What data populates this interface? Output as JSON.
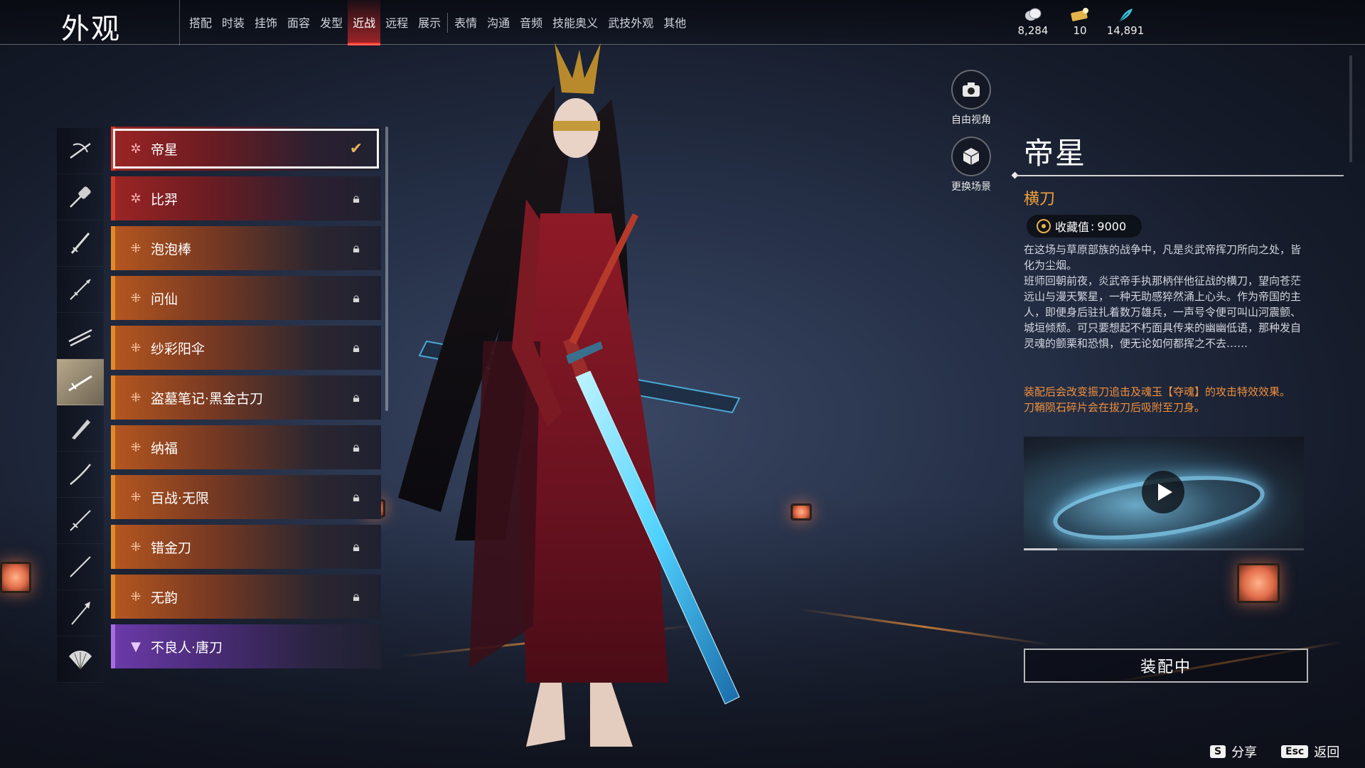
{
  "header": {
    "title": "外观",
    "tabs": [
      {
        "label": "搭配"
      },
      {
        "label": "时装"
      },
      {
        "label": "挂饰"
      },
      {
        "label": "面容"
      },
      {
        "label": "发型"
      },
      {
        "label": "近战",
        "active": true
      },
      {
        "label": "远程"
      },
      {
        "label": "展示"
      },
      {
        "label": "表情"
      },
      {
        "label": "沟通"
      },
      {
        "label": "音频"
      },
      {
        "label": "技能奥义"
      },
      {
        "label": "武技外观"
      },
      {
        "label": "其他"
      }
    ],
    "currencies": [
      {
        "icon": "coins-icon",
        "value": "8,284"
      },
      {
        "icon": "ticket-icon",
        "value": "10"
      },
      {
        "icon": "feather-icon",
        "value": "14,891"
      }
    ]
  },
  "categories": [
    {
      "icon": "scythe-icon"
    },
    {
      "icon": "mace-icon"
    },
    {
      "icon": "sword-icon"
    },
    {
      "icon": "spear-icon"
    },
    {
      "icon": "twin-blades-icon"
    },
    {
      "icon": "long-saber-icon",
      "active": true
    },
    {
      "icon": "broad-blade-icon"
    },
    {
      "icon": "katana-icon"
    },
    {
      "icon": "dual-swords-icon"
    },
    {
      "icon": "staff-icon"
    },
    {
      "icon": "glaive-icon"
    },
    {
      "icon": "fan-icon"
    }
  ],
  "items": [
    {
      "name": "帝星",
      "rarity": "red",
      "selected": true,
      "equipped": true,
      "locked": false
    },
    {
      "name": "比羿",
      "rarity": "red",
      "locked": true
    },
    {
      "name": "泡泡棒",
      "rarity": "gold",
      "locked": true
    },
    {
      "name": "问仙",
      "rarity": "gold",
      "locked": true
    },
    {
      "name": "纱彩阳伞",
      "rarity": "gold",
      "locked": true
    },
    {
      "name": "盗墓笔记·黑金古刀",
      "rarity": "gold",
      "locked": true
    },
    {
      "name": "纳福",
      "rarity": "gold",
      "locked": true
    },
    {
      "name": "百战·无限",
      "rarity": "gold",
      "locked": true
    },
    {
      "name": "错金刀",
      "rarity": "gold",
      "locked": true
    },
    {
      "name": "无韵",
      "rarity": "gold",
      "locked": true
    },
    {
      "name": "不良人·唐刀",
      "rarity": "purple",
      "locked": false
    }
  ],
  "side_buttons": {
    "free_view": "自由视角",
    "change_scene": "更换场景"
  },
  "detail": {
    "name": "帝星",
    "type": "横刀",
    "collect_label": "收藏值",
    "collect_value": "9000",
    "description": [
      "在这场与草原部族的战争中，凡是炎武帝挥刀所向之处，皆化为尘烟。",
      "班师回朝前夜，炎武帝手执那柄伴他征战的横刀，望向苍茫远山与漫天繁星，一种无助感猝然涌上心头。作为帝国的主人，即便身后驻扎着数万雄兵，一声号令便可叫山河震颤、城垣倾颓。可只要想起不朽面具传来的幽幽低语，那种发自灵魂的颤栗和恐惧，便无论如何都挥之不去……"
    ],
    "effect": [
      "装配后会改变振刀追击及魂玉【夺魂】的攻击特效效果。",
      "刀鞘陨石碎片会在拔刀后吸附至刀身。"
    ],
    "video_progress": 0.12,
    "equip_label": "装配中"
  },
  "hints": [
    {
      "key": "S",
      "label": "分享"
    },
    {
      "key": "Esc",
      "label": "返回"
    }
  ],
  "colors": {
    "accent_red": "#ff3b30",
    "rarity_gold": "#e08a2c",
    "rarity_red": "#d03a2a",
    "rarity_purple": "#a66ce0",
    "type_orange": "#f0a13b",
    "effect_orange": "#ef8f3d"
  }
}
